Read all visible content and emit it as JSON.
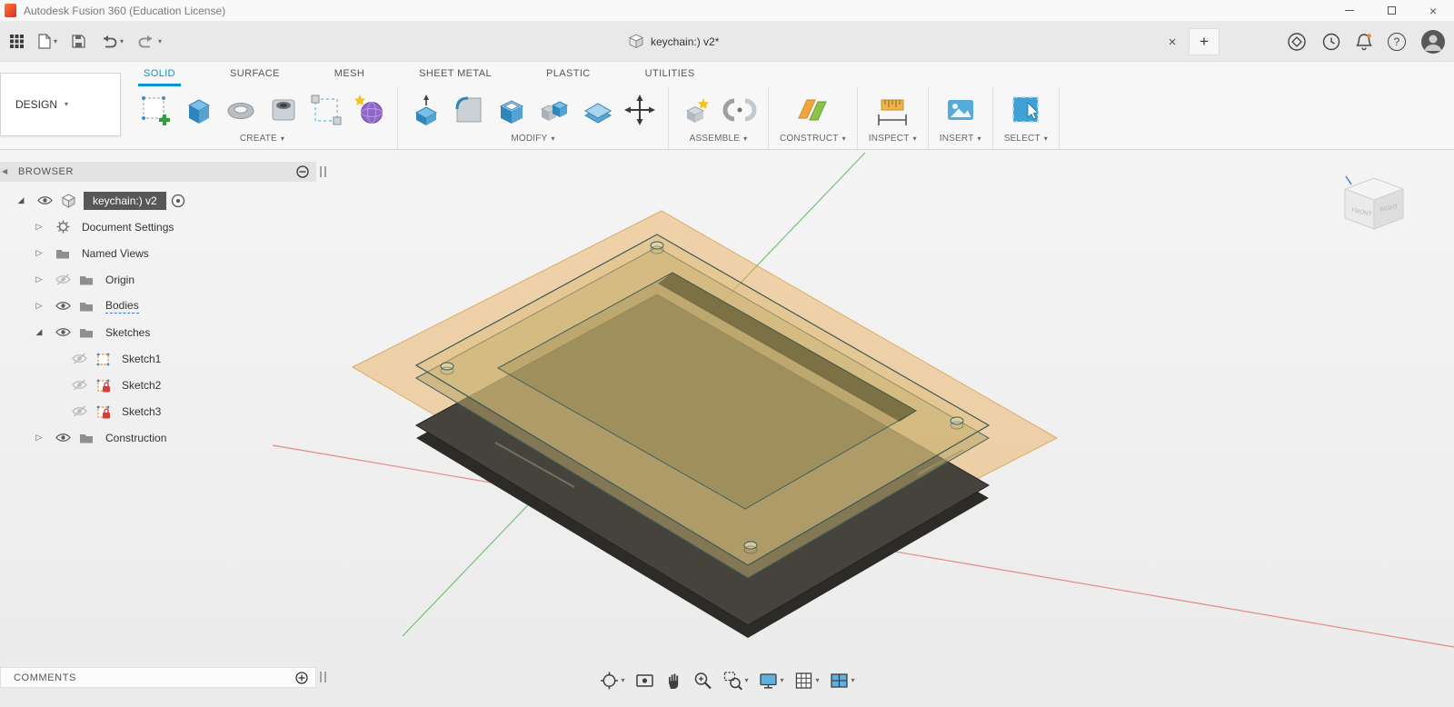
{
  "window": {
    "title": "Autodesk Fusion 360 (Education License)"
  },
  "document": {
    "tab_label": "keychain:) v2*"
  },
  "workspace": {
    "selector_label": "DESIGN"
  },
  "ribbon_tabs": [
    "SOLID",
    "SURFACE",
    "MESH",
    "SHEET METAL",
    "PLASTIC",
    "UTILITIES"
  ],
  "active_tab": "SOLID",
  "ribbon_groups": [
    "CREATE",
    "MODIFY",
    "ASSEMBLE",
    "CONSTRUCT",
    "INSPECT",
    "INSERT",
    "SELECT"
  ],
  "browser": {
    "header": "BROWSER",
    "root_label": "keychain:) v2",
    "items": {
      "document_settings": "Document Settings",
      "named_views": "Named Views",
      "origin": "Origin",
      "bodies": "Bodies",
      "sketches": "Sketches",
      "sketch1": "Sketch1",
      "sketch2": "Sketch2",
      "sketch3": "Sketch3",
      "construction": "Construction"
    }
  },
  "comments": {
    "header": "COMMENTS"
  },
  "viewcube": {
    "front_label": "FRONT",
    "right_label": "RIGHT"
  },
  "glyphs": {
    "caret_down": "▾",
    "expand_closed": "▷",
    "expand_open": "◢",
    "collapse_panel_left": "◀",
    "add": "+",
    "close": "×",
    "help": "?"
  },
  "colors": {
    "accent_blue": "#0696d7",
    "sketch_plane_orange": "#eaa94f",
    "body_dark": "#45433b",
    "axis_red": "#e25f5f",
    "axis_green": "#44a944",
    "selection_gray": "#575757"
  },
  "icons": {
    "fusion-logo-icon": "orange gradient square",
    "app-grid-icon": "3x3 dark squares",
    "file-new-icon": "page with folded corner",
    "save-icon": "floppy disk",
    "undo-icon": "curved left arrow",
    "redo-icon": "curved right arrow",
    "document-cube-icon": "gray cube",
    "extensions-icon": "circle with rotated square",
    "job-status-icon": "clock",
    "notifications-icon": "bell",
    "help-icon": "? in circle",
    "avatar-icon": "person silhouette in circle",
    "create-sketch-icon": "dashed square with green plus",
    "extrude-icon": "blue iso cube",
    "revolve-icon": "gray torus",
    "hole-icon": "block with hole",
    "pattern-icon": "dashed square with corner blocks",
    "form-icon": "purple sphere with star",
    "press-pull-icon": "blue slab with up arrow",
    "fillet-icon": "rounded corner block",
    "shell-icon": "hollow blue box",
    "combine-icon": "two overlapping boxes",
    "offset-face-icon": "stacked blue slabs",
    "move-icon": "black four-way arrows",
    "new-component-icon": "box with yellow star",
    "joint-icon": "two gray jaws",
    "construct-plane-icon": "orange and green planes",
    "measure-icon": "ruler with extents",
    "insert-image-icon": "photo with mountain",
    "select-icon": "blue square with cursor",
    "eye-icon": "visibility eye",
    "eye-hidden-icon": "grayed eye with slash",
    "folder-icon": "gray folder",
    "gear-icon": "gear wheel",
    "target-icon": "circle with dot",
    "sketch-tree-icon": "orange dashed square with blue dots",
    "lock-icon": "red padlock",
    "orbit-icon": "circle with crosshair",
    "look-at-icon": "plane with eye",
    "pan-icon": "hand",
    "zoom-icon": "magnifier with plus",
    "fit-icon": "magnifier with dashed frame",
    "display-settings-icon": "monitor",
    "grid-settings-icon": "grid square",
    "viewports-icon": "2x2 split frame"
  }
}
